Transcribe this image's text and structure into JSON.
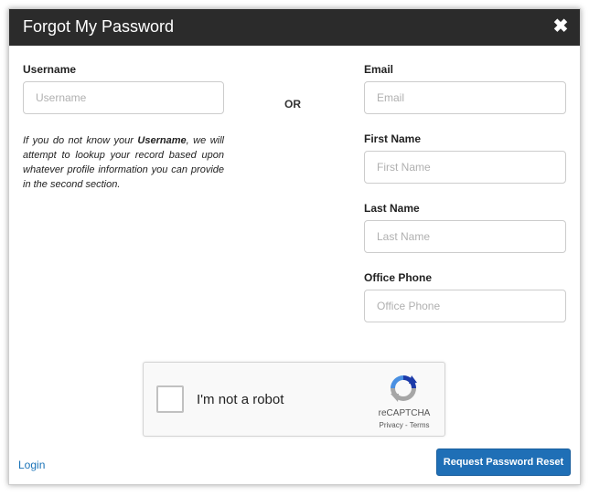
{
  "modal": {
    "title": "Forgot My Password",
    "close_glyph": "✖"
  },
  "left": {
    "username_label": "Username",
    "username_placeholder": "Username",
    "username_value": "",
    "help_prefix": "If you do not know your ",
    "help_emphasis": "Username",
    "help_suffix": ", we will attempt to lookup your record based upon whatever profile information you can provide in the second section."
  },
  "divider": {
    "or_text": "OR"
  },
  "right": {
    "email_label": "Email",
    "email_placeholder": "Email",
    "first_name_label": "First Name",
    "first_name_placeholder": "First Name",
    "last_name_label": "Last Name",
    "last_name_placeholder": "Last Name",
    "office_phone_label": "Office Phone",
    "office_phone_placeholder": "Office Phone"
  },
  "recaptcha": {
    "label": "I'm not a robot",
    "brand": "reCAPTCHA",
    "links": "Privacy - Terms",
    "icon": "recaptcha-logo-icon"
  },
  "footer": {
    "login_link": "Login",
    "submit_label": "Request Password Reset"
  },
  "colors": {
    "header_bg": "#2b2b2b",
    "primary_button": "#1f6fb6",
    "link": "#1a73b8"
  }
}
